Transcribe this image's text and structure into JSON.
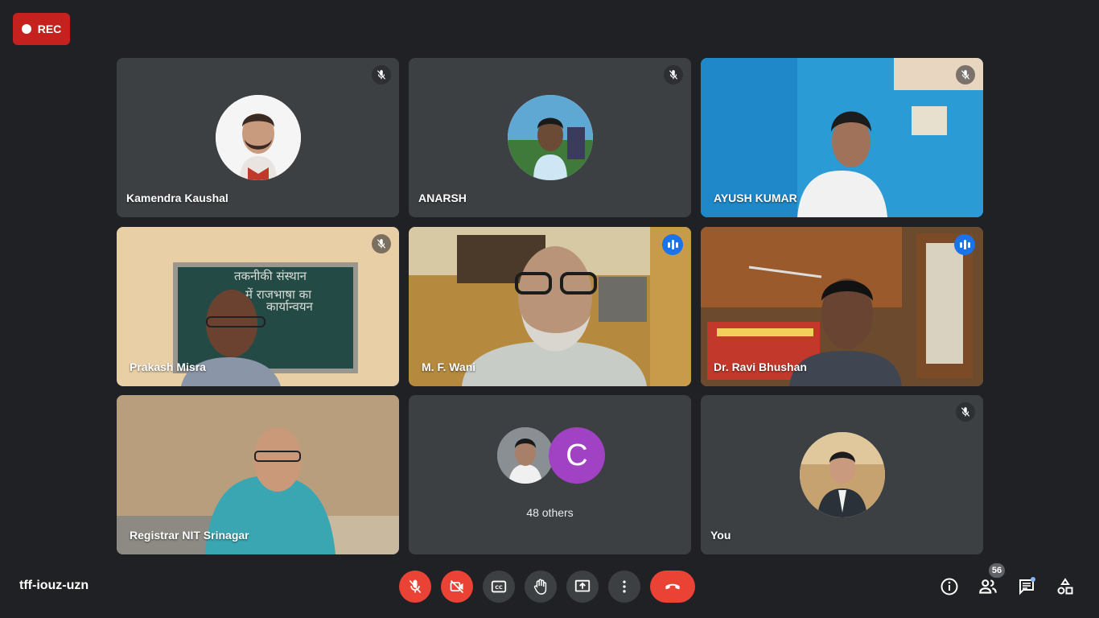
{
  "recording": {
    "label": "REC"
  },
  "meeting": {
    "code": "tff-iouz-uzn"
  },
  "participants": [
    {
      "name": "Kamendra Kaushal"
    },
    {
      "name": "ANARSH"
    },
    {
      "name": "AYUSH KUMAR"
    },
    {
      "name": "Prakash Misra"
    },
    {
      "name": "M. F. Wani"
    },
    {
      "name": "Dr. Ravi Bhushan"
    },
    {
      "name": "Registrar NIT Srinagar"
    },
    {
      "others_label": "48 others",
      "avatar_letter": "C"
    },
    {
      "name": "You"
    }
  ],
  "board_text": [
    "तकनीकी संस्थान",
    "में राजभाषा का",
    "कार्यान्वयन"
  ],
  "controls": {
    "mic": "mic-off-icon",
    "camera": "camera-off-icon",
    "captions": "CC",
    "hand": "raise-hand-icon",
    "present": "present-icon",
    "more": "more-icon",
    "hangup": "hangup-icon"
  },
  "right_panel": {
    "people_count": "56"
  },
  "colors": {
    "accent": "#1a73e8",
    "danger": "#ea4335",
    "bg": "#202124",
    "tile": "#3c4043"
  }
}
